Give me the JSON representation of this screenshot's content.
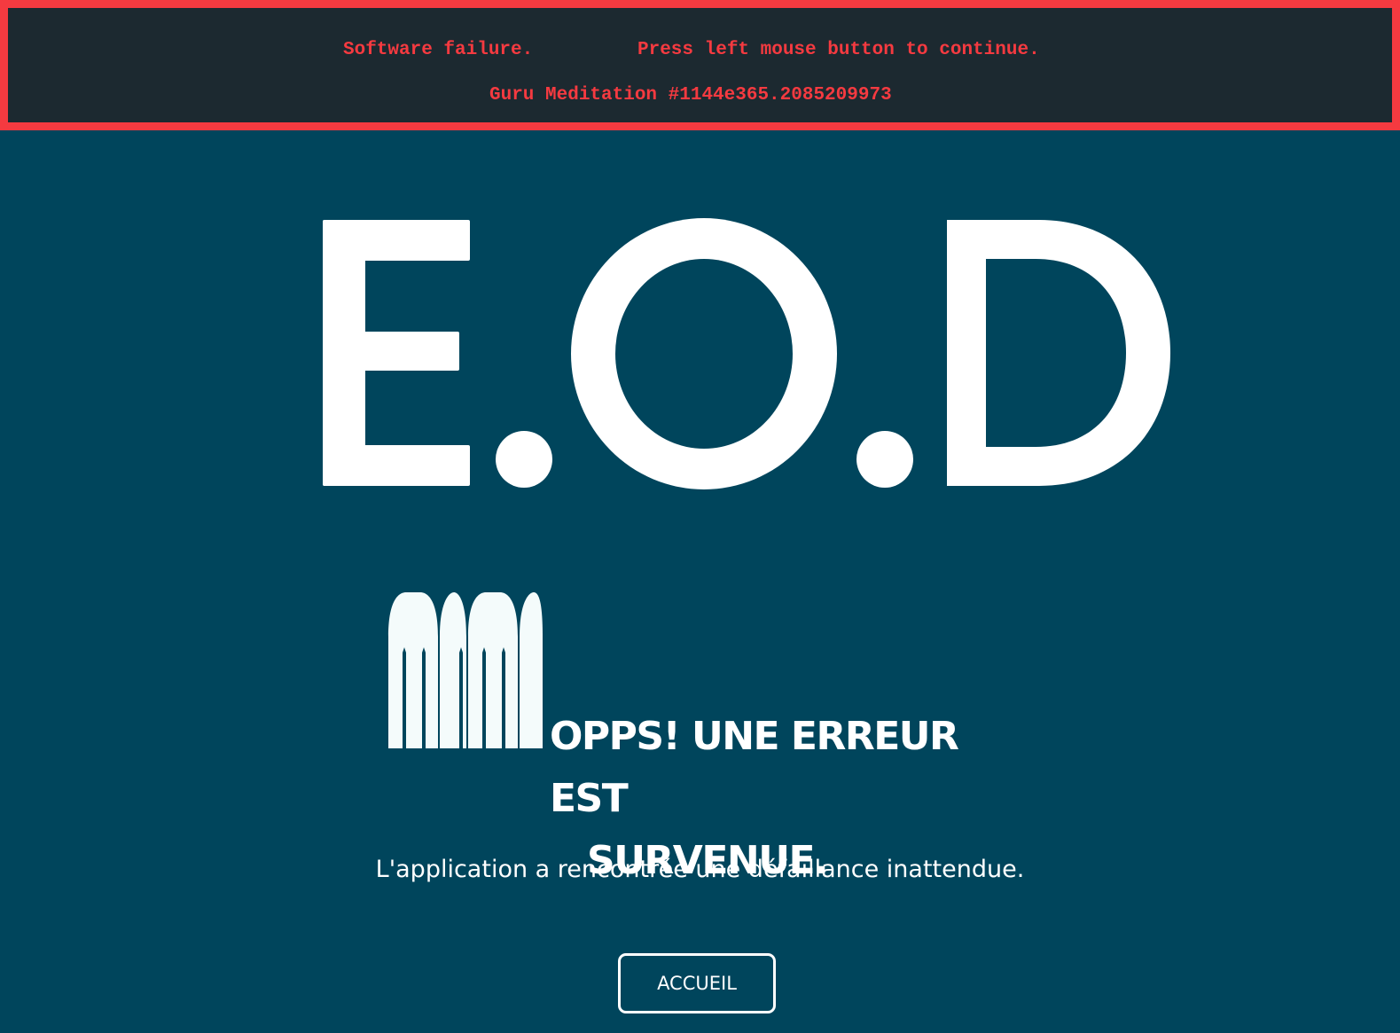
{
  "guru_banner": {
    "failure_text": "Software failure.",
    "continue_text": "Press left mouse button to continue.",
    "meditation_text": "Guru Meditation #1144e365.2085209973",
    "border_color": "#f53a40",
    "background_color": "#1c2930"
  },
  "logo": {
    "text": "E.O.D",
    "color": "#ffffff"
  },
  "error": {
    "icon": "bullets-icon",
    "headline_line1": "OPPS! UNE ERREUR EST",
    "headline_line2": "SURVENUE.",
    "message": "L'application a rencontrée une défaillance inattendue."
  },
  "actions": {
    "home_label": "ACCUEIL"
  },
  "colors": {
    "page_background": "#00455c",
    "text": "#ffffff"
  }
}
